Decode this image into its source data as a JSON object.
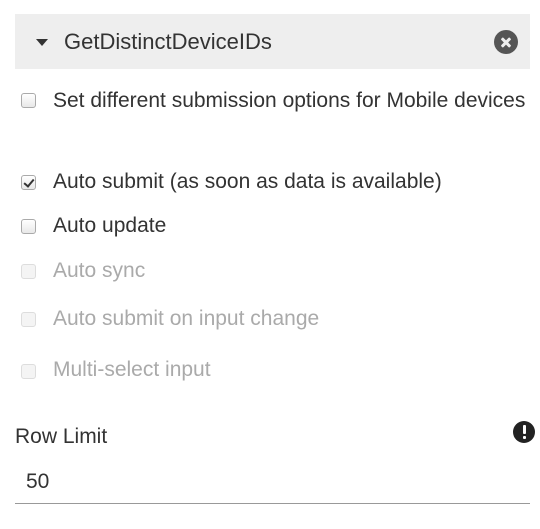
{
  "header": {
    "title": "GetDistinctDeviceIDs"
  },
  "options": {
    "mobile_submission": {
      "label": "Set different submission options for Mobile devices",
      "checked": false,
      "disabled": false
    },
    "auto_submit": {
      "label": "Auto submit (as soon as data is available)",
      "checked": true,
      "disabled": false
    },
    "auto_update": {
      "label": "Auto update",
      "checked": false,
      "disabled": false
    },
    "auto_sync": {
      "label": "Auto sync",
      "checked": false,
      "disabled": true
    },
    "auto_submit_on_change": {
      "label": "Auto submit on input change",
      "checked": false,
      "disabled": true
    },
    "multi_select": {
      "label": "Multi-select input",
      "checked": false,
      "disabled": true
    }
  },
  "row_limit": {
    "label": "Row Limit",
    "value": "50"
  },
  "colors": {
    "header_bg": "#eeeeee",
    "text": "#333333",
    "disabled_text": "#aaaaaa"
  }
}
